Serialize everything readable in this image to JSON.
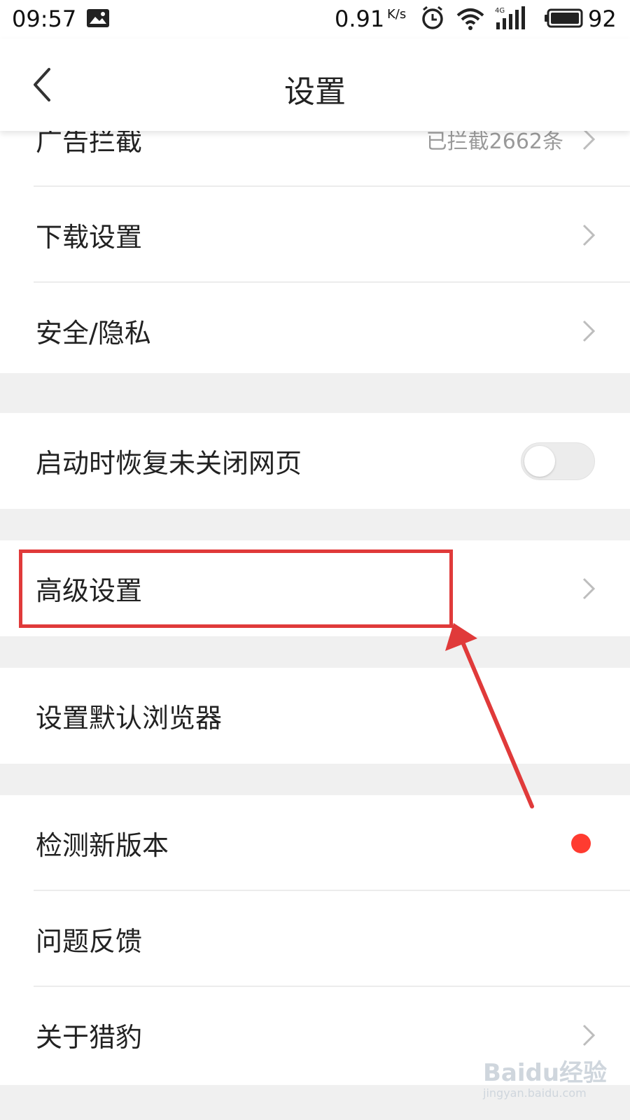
{
  "status_bar": {
    "time": "09:57",
    "speed": "0.91",
    "speed_unit": "K/s",
    "battery_level": "92",
    "icons": [
      "image-icon",
      "alarm-icon",
      "wifi-icon",
      "signal-4g-icon",
      "battery-icon"
    ]
  },
  "header": {
    "title": "设置",
    "back_icon": "back-chevron-icon"
  },
  "sections": [
    {
      "items": [
        {
          "label": "广告拦截",
          "value": "已拦截2662条",
          "accessory": "chevron"
        },
        {
          "label": "下载设置",
          "accessory": "chevron"
        },
        {
          "label": "安全/隐私",
          "accessory": "chevron"
        }
      ]
    },
    {
      "items": [
        {
          "label": "启动时恢复未关闭网页",
          "accessory": "toggle",
          "toggle_on": false
        }
      ]
    },
    {
      "items": [
        {
          "label": "高级设置",
          "accessory": "chevron",
          "highlighted": true
        }
      ]
    },
    {
      "items": [
        {
          "label": "设置默认浏览器",
          "accessory": "none"
        }
      ]
    },
    {
      "items": [
        {
          "label": "检测新版本",
          "accessory": "red-dot"
        },
        {
          "label": "问题反馈",
          "accessory": "none"
        },
        {
          "label": "关于猎豹",
          "accessory": "chevron"
        }
      ]
    }
  ],
  "annotation": {
    "color": "#e03a3a"
  },
  "watermark": {
    "main": "Baidu经验",
    "sub": "jingyan.baidu.com"
  },
  "colors": {
    "accent_red": "#ff3b30",
    "background": "#f0f0f0"
  }
}
